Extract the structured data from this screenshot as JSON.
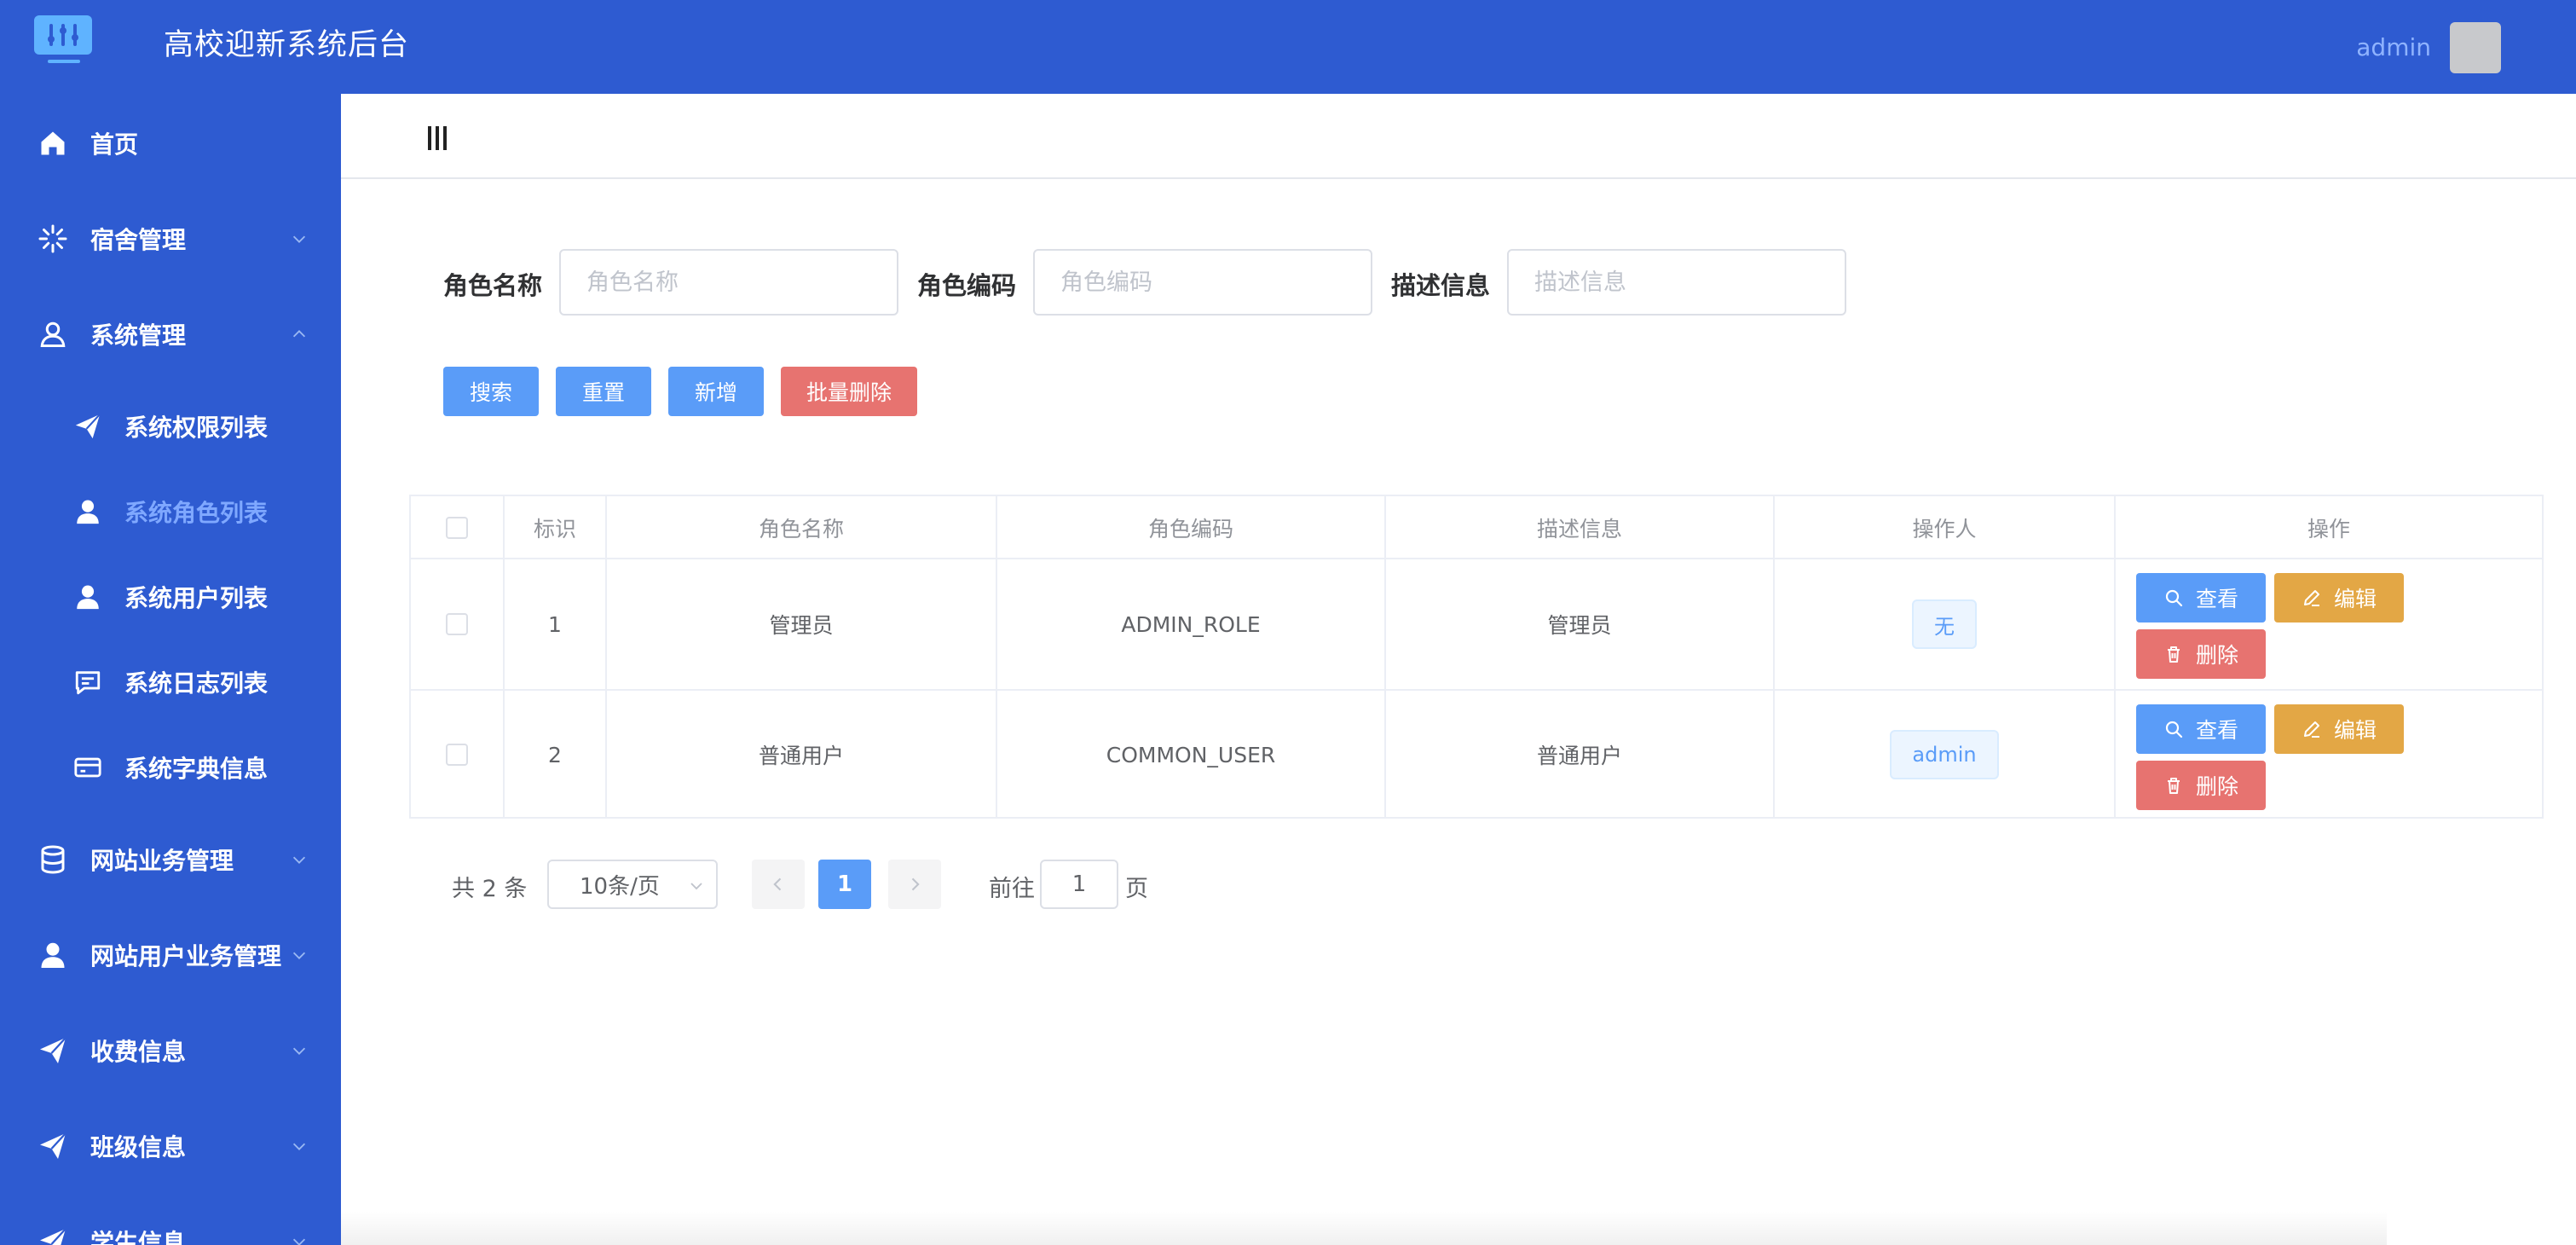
{
  "header": {
    "app_title": "高校迎新系统后台",
    "user_name": "admin",
    "brand_color": "#2e5bd1"
  },
  "sidebar": {
    "items": [
      {
        "label": "首页",
        "icon": "home-icon"
      },
      {
        "label": "宿舍管理",
        "icon": "loading-icon",
        "expandable": true
      },
      {
        "label": "系统管理",
        "icon": "user-outline-icon",
        "expanded": true
      },
      {
        "label": "网站业务管理",
        "icon": "database-icon",
        "expandable": true
      },
      {
        "label": "网站用户业务管理",
        "icon": "user-solid-icon",
        "expandable": true
      },
      {
        "label": "收费信息",
        "icon": "paper-plane-icon",
        "expandable": true
      },
      {
        "label": "班级信息",
        "icon": "paper-plane-icon",
        "expandable": true
      },
      {
        "label": "学生信息",
        "icon": "paper-plane-icon",
        "expandable": true
      }
    ],
    "sub_items": [
      {
        "label": "系统权限列表",
        "icon": "paper-plane-icon"
      },
      {
        "label": "系统角色列表",
        "icon": "user-solid-icon",
        "active": true
      },
      {
        "label": "系统用户列表",
        "icon": "user-solid-icon"
      },
      {
        "label": "系统日志列表",
        "icon": "chat-icon"
      },
      {
        "label": "系统字典信息",
        "icon": "credit-card-icon"
      }
    ],
    "active_color": "#7fa8ff"
  },
  "search": {
    "role_name_label": "角色名称",
    "role_name_placeholder": "角色名称",
    "role_code_label": "角色编码",
    "role_code_placeholder": "角色编码",
    "description_label": "描述信息",
    "description_placeholder": "描述信息",
    "search_button": "搜索",
    "reset_button": "重置",
    "add_button": "新增",
    "batch_delete_button": "批量删除"
  },
  "table": {
    "columns": [
      "标识",
      "角色名称",
      "角色编码",
      "描述信息",
      "操作人",
      "操作"
    ],
    "rows": [
      {
        "id": "1",
        "name": "管理员",
        "code": "ADMIN_ROLE",
        "description": "管理员",
        "operator": "无"
      },
      {
        "id": "2",
        "name": "普通用户",
        "code": "COMMON_USER",
        "description": "普通用户",
        "operator": "admin"
      }
    ],
    "actions": {
      "view": "查看",
      "edit": "编辑",
      "delete": "删除"
    }
  },
  "pagination": {
    "total_text": "共 2 条",
    "page_size": "10条/页",
    "current_page": "1",
    "goto_prefix": "前往",
    "goto_value": "1",
    "goto_suffix": "页"
  },
  "colors": {
    "primary": "#5a9cf8",
    "danger": "#e77370",
    "warning": "#e3a745"
  }
}
